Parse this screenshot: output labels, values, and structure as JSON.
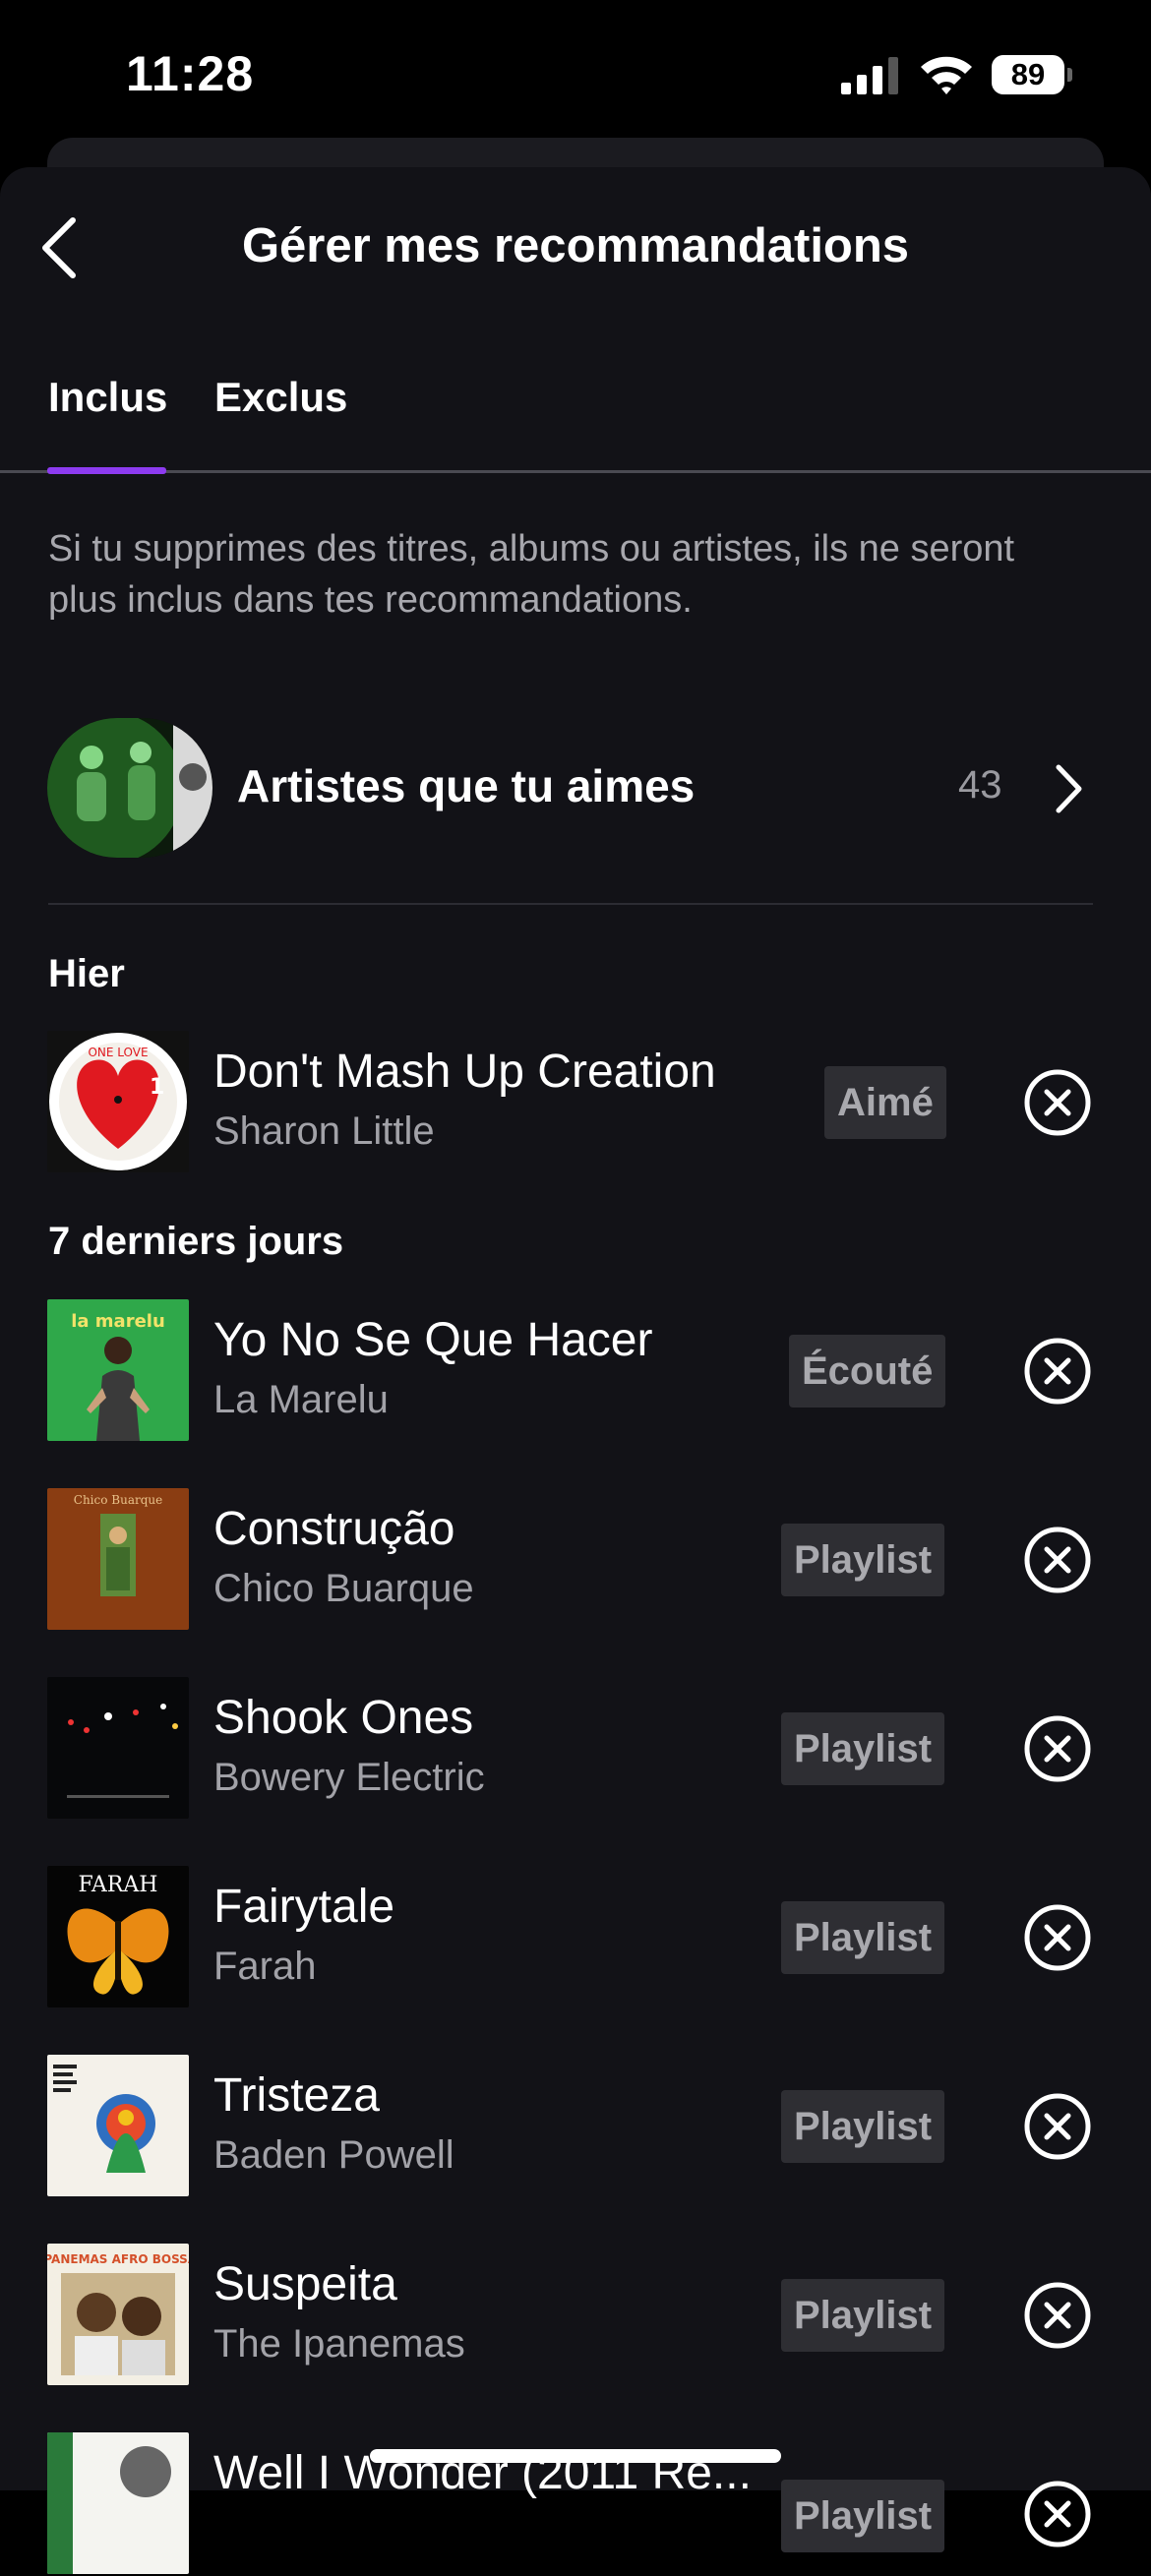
{
  "status_bar": {
    "time": "11:28",
    "battery": "89"
  },
  "header": {
    "title": "Gérer mes recommandations"
  },
  "tabs": [
    {
      "label": "Inclus",
      "active": true
    },
    {
      "label": "Exclus",
      "active": false
    }
  ],
  "description": "Si tu supprimes des titres, albums ou artistes, ils ne seront plus inclus dans tes recommandations.",
  "artists": {
    "label": "Artistes que tu aimes",
    "count": "43"
  },
  "sections": {
    "yesterday": "Hier",
    "last7": "7 derniers jours"
  },
  "tracks": [
    {
      "title": "Don't Mash Up Creation",
      "artist": "Sharon Little",
      "tag": "Aimé"
    },
    {
      "title": "Yo No Se Que Hacer",
      "artist": "La Marelu",
      "tag": "Écouté"
    },
    {
      "title": "Construção",
      "artist": "Chico Buarque",
      "tag": "Playlist"
    },
    {
      "title": "Shook Ones",
      "artist": "Bowery Electric",
      "tag": "Playlist"
    },
    {
      "title": "Fairytale",
      "artist": "Farah",
      "tag": "Playlist"
    },
    {
      "title": "Tristeza",
      "artist": "Baden Powell",
      "tag": "Playlist"
    },
    {
      "title": "Suspeita",
      "artist": "The Ipanemas",
      "tag": "Playlist"
    },
    {
      "title": "Well I Wonder (2011 Re...",
      "artist": "",
      "tag": "Playlist"
    }
  ],
  "cover_art_text": {
    "la_marelu": "la marelu",
    "chico": "Chico Buarque",
    "farah": "FARAH",
    "ipanemas": "IPANEMAS AFRO BOSSA"
  },
  "colors": {
    "accent": "#8d3bf0",
    "sheet": "#121217",
    "tag_bg": "#2e2e33"
  }
}
